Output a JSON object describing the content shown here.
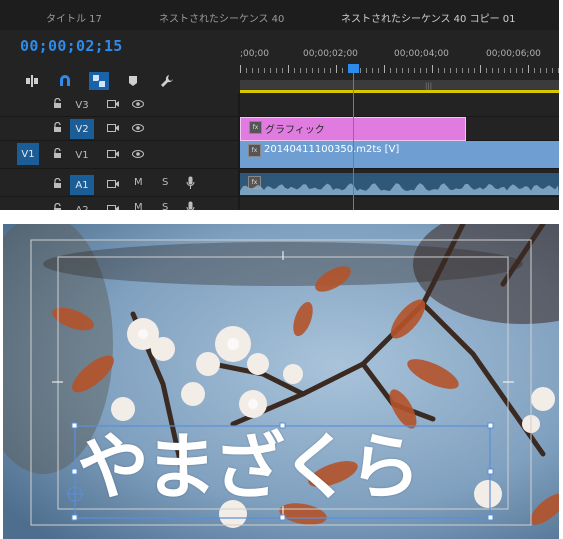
{
  "timeline": {
    "tabs": [
      "タイトル 17",
      "ネストされたシーケンス 40",
      "ネストされたシーケンス 40 コピー 01"
    ],
    "current_timecode": "00;00;02;15",
    "ruler_labels": [
      ";00;00",
      "00;00;02;00",
      "00;00;04;00",
      "00;00;06;00"
    ],
    "source_patch": "V1",
    "tracks": [
      {
        "name": "V3",
        "type": "video",
        "selected": false
      },
      {
        "name": "V2",
        "type": "video",
        "selected": true
      },
      {
        "name": "V1",
        "type": "video",
        "selected": false
      },
      {
        "name": "A1",
        "type": "audio",
        "selected": true
      },
      {
        "name": "A2",
        "type": "audio",
        "selected": false
      }
    ],
    "audio_buttons": {
      "mute": "M",
      "solo": "S"
    },
    "clips": {
      "graphic": "グラフィック",
      "video": "20140411100350.m2ts [V]"
    }
  },
  "monitor": {
    "title_text": "やまざくら"
  },
  "colors": {
    "accent_blue": "#2d8ceb",
    "graphic_clip": "#e07be0",
    "video_clip": "#6f9ed3",
    "audio_clip": "#2f5878",
    "work_area": "#d9c700"
  },
  "icons": [
    "ripple-edit-icon",
    "snap-magnet-icon",
    "linked-selection-icon",
    "add-marker-icon",
    "wrench-icon",
    "lock-icon",
    "camera-icon",
    "eye-icon",
    "mic-icon"
  ]
}
